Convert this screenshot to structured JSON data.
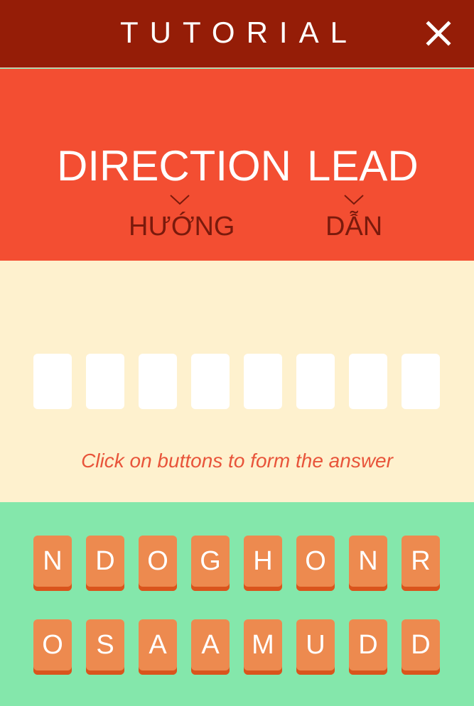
{
  "header": {
    "title": "TUTORIAL",
    "close_icon": "close-icon"
  },
  "question": {
    "words": [
      "DIRECTION",
      "LEAD"
    ],
    "meanings": [
      "HƯỚNG",
      "DẪN"
    ]
  },
  "answer": {
    "slot_count": 8,
    "hint": "Click on buttons to form the answer"
  },
  "letters": {
    "row1": [
      "N",
      "D",
      "O",
      "G",
      "H",
      "O",
      "N",
      "R"
    ],
    "row2": [
      "O",
      "S",
      "A",
      "A",
      "M",
      "U",
      "D",
      "D"
    ]
  },
  "colors": {
    "header": "#951d07",
    "question_bg": "#f34e32",
    "answer_bg": "#fef1ce",
    "keys_bg": "#84e7ab",
    "key": "#ed8a4f",
    "key_shadow": "#d9541c"
  }
}
